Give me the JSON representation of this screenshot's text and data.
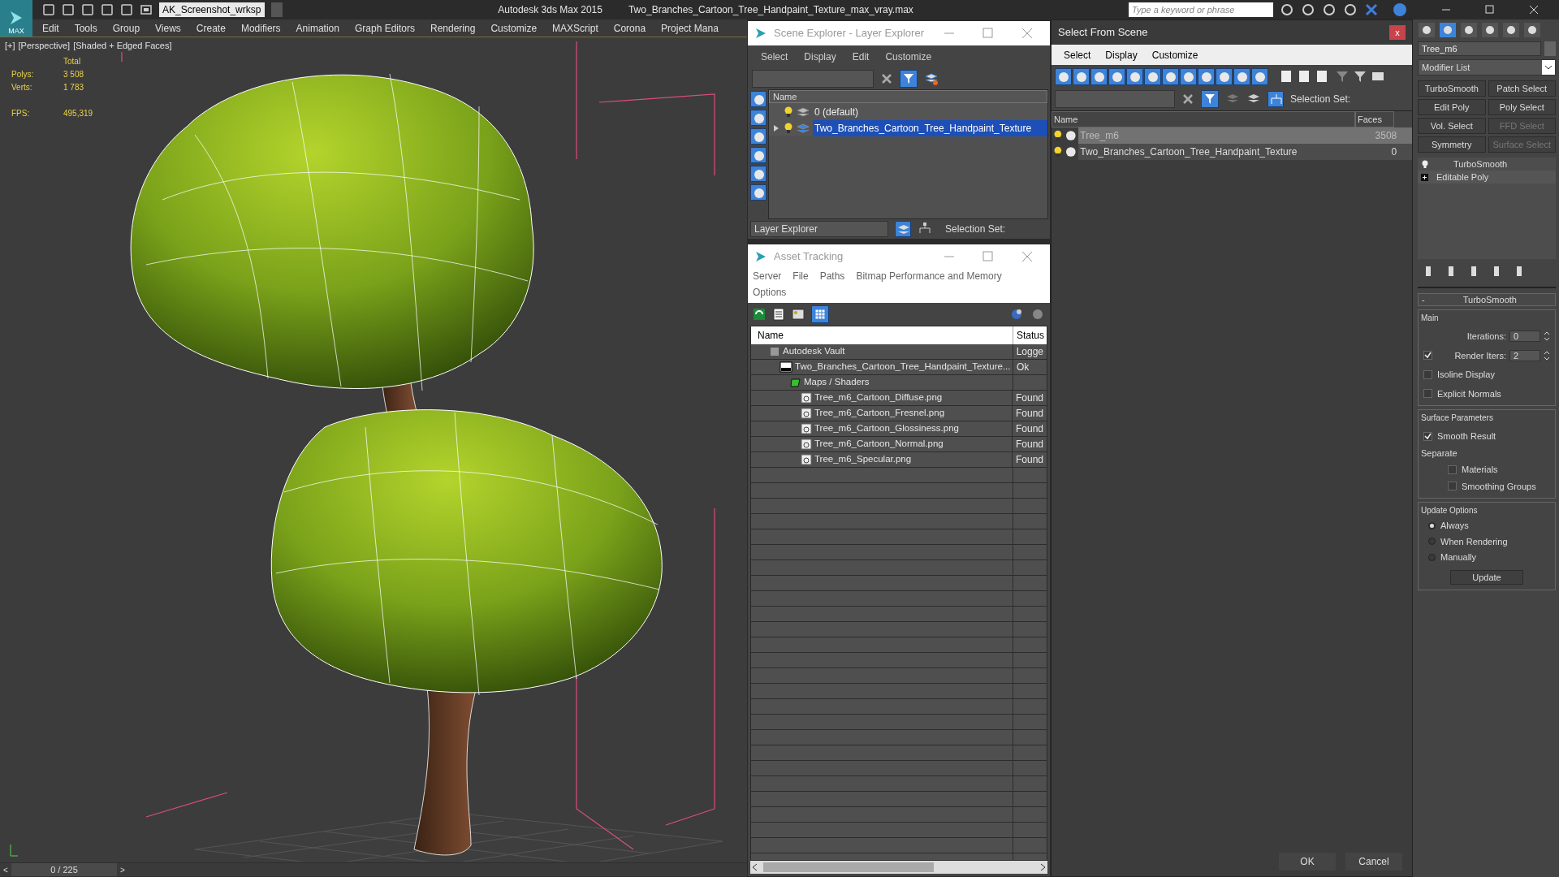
{
  "title_bar": {
    "logo_text": "MAX",
    "workspace": "AK_Screenshot_wrksp",
    "app_title": "Autodesk 3ds Max  2015",
    "document": "Two_Branches_Cartoon_Tree_Handpaint_Texture_max_vray.max",
    "search_placeholder": "Type a keyword or phrase"
  },
  "menu": [
    "Edit",
    "Tools",
    "Group",
    "Views",
    "Create",
    "Modifiers",
    "Animation",
    "Graph Editors",
    "Rendering",
    "Customize",
    "MAXScript",
    "Corona",
    "Project Mana"
  ],
  "viewport": {
    "labels": [
      "[+]",
      "[Perspective]",
      "[Shaded + Edged Faces]"
    ],
    "stats_header": "Total",
    "stats": [
      {
        "label": "Polys:",
        "value": "3 508"
      },
      {
        "label": "Verts:",
        "value": "1 783"
      }
    ],
    "fps_label": "FPS:",
    "fps": "495,319"
  },
  "timeline": {
    "prev": "<",
    "position": "0 / 225",
    "level": 0,
    "next": ">"
  },
  "scene_explorer": {
    "title": "Scene Explorer - Layer Explorer",
    "menu": [
      "Select",
      "Display",
      "Edit",
      "Customize"
    ],
    "column": "Name",
    "rows": [
      {
        "name": "0 (default)",
        "selected": false,
        "expandable": false
      },
      {
        "name": "Two_Branches_Cartoon_Tree_Handpaint_Texture",
        "selected": true,
        "expandable": true
      }
    ],
    "mode": "Layer Explorer",
    "selection_set_label": "Selection Set:"
  },
  "asset_tracking": {
    "title": "Asset Tracking",
    "menu": [
      "Server",
      "File",
      "Paths",
      "Bitmap Performance and Memory",
      "Options"
    ],
    "columns": [
      "Name",
      "Status"
    ],
    "rows": [
      {
        "kind": "vault",
        "name": "Autodesk Vault",
        "status": "Logge",
        "children": [
          {
            "kind": "scene",
            "name": "Two_Branches_Cartoon_Tree_Handpaint_Texture...",
            "status": "Ok",
            "children": [
              {
                "kind": "folder",
                "name": "Maps / Shaders",
                "children": [
                  {
                    "kind": "image",
                    "name": "Tree_m6_Cartoon_Diffuse.png",
                    "status": "Found"
                  },
                  {
                    "kind": "image",
                    "name": "Tree_m6_Cartoon_Fresnel.png",
                    "status": "Found"
                  },
                  {
                    "kind": "image",
                    "name": "Tree_m6_Cartoon_Glossiness.png",
                    "status": "Found"
                  },
                  {
                    "kind": "image",
                    "name": "Tree_m6_Cartoon_Normal.png",
                    "status": "Found"
                  },
                  {
                    "kind": "image",
                    "name": "Tree_m6_Specular.png",
                    "status": "Found"
                  }
                ]
              }
            ]
          }
        ]
      }
    ]
  },
  "select_from_scene": {
    "title": "Select From Scene",
    "close": "x",
    "menu": [
      "Select",
      "Display",
      "Customize"
    ],
    "selection_set_label": "Selection Set:",
    "columns": [
      "Name",
      "Faces"
    ],
    "rows": [
      {
        "name": "Tree_m6",
        "faces": "3508",
        "selected": true
      },
      {
        "name": "Two_Branches_Cartoon_Tree_Handpaint_Texture",
        "faces": "0",
        "selected": false
      }
    ],
    "buttons": [
      "OK",
      "Cancel"
    ]
  },
  "command_panel": {
    "object_name": "Tree_m6",
    "modifier_list": "Modifier List",
    "modifier_buttons": [
      {
        "label": "TurboSmooth",
        "disabled": false
      },
      {
        "label": "Patch Select",
        "disabled": false
      },
      {
        "label": "Edit Poly",
        "disabled": false
      },
      {
        "label": "Poly Select",
        "disabled": false
      },
      {
        "label": "Vol. Select",
        "disabled": false
      },
      {
        "label": "FFD Select",
        "disabled": true
      },
      {
        "label": "Symmetry",
        "disabled": false
      },
      {
        "label": "Surface Select",
        "disabled": true
      }
    ],
    "stack": [
      {
        "kind": "modifier",
        "name": "TurboSmooth"
      },
      {
        "kind": "base",
        "name": "Editable Poly"
      }
    ],
    "rollout": {
      "collapse": "-",
      "title": "TurboSmooth",
      "main_label": "Main",
      "iterations_label": "Iterations:",
      "iterations": "0",
      "render_iters": {
        "label": "Render Iters:",
        "checked": true,
        "value": "2"
      },
      "main_options": [
        {
          "label": "Isoline Display",
          "checked": false
        },
        {
          "label": "Explicit Normals",
          "checked": false
        }
      ],
      "surface_label": "Surface Parameters",
      "smooth_result": {
        "label": "Smooth Result",
        "checked": true
      },
      "separate_label": "Separate",
      "separate": [
        {
          "label": "Materials",
          "checked": false
        },
        {
          "label": "Smoothing Groups",
          "checked": false
        }
      ],
      "update_label": "Update Options",
      "update_modes": [
        {
          "label": "Always",
          "selected": true
        },
        {
          "label": "When Rendering",
          "selected": false
        },
        {
          "label": "Manually",
          "selected": false
        }
      ],
      "update_button": "Update"
    }
  }
}
